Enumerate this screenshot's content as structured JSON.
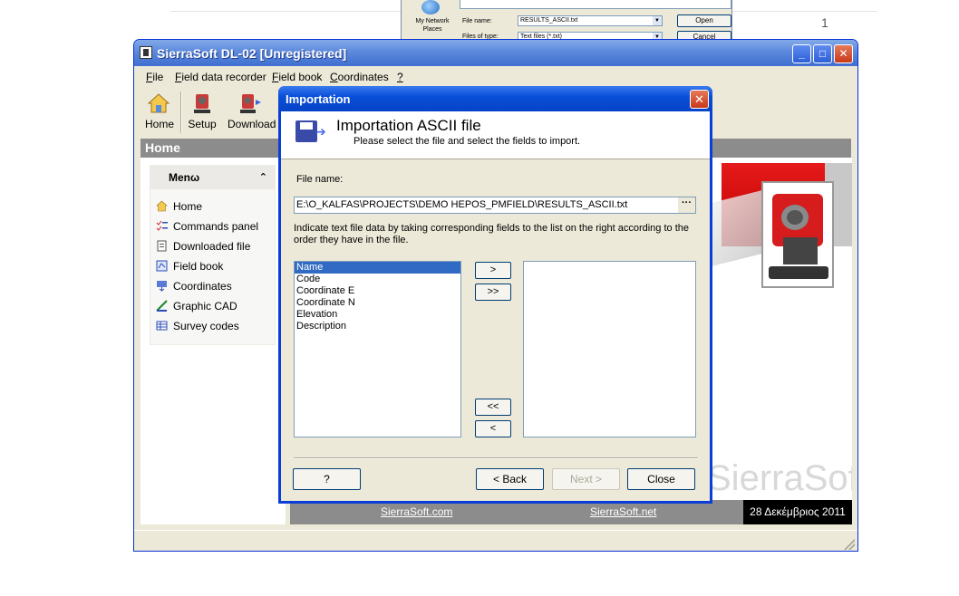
{
  "background": {
    "page_number": "1",
    "file_dialog": {
      "places_label": "My Network Places",
      "file_name_label": "File name:",
      "file_name_value": "RESULTS_ASCII.txt",
      "file_type_label": "Files of type:",
      "file_type_value": "Text files (*.txt)",
      "open_label": "Open",
      "cancel_label": "Cancel"
    }
  },
  "main_window": {
    "title": "SierraSoft DL-02 [Unregistered]",
    "controls": {
      "minimize": "_",
      "maximize": "□",
      "close": "✕"
    },
    "menu": [
      {
        "mnemonic": "F",
        "rest": "ile"
      },
      {
        "mnemonic": "F",
        "rest": "ield data recorder"
      },
      {
        "mnemonic": "F",
        "rest": "ield book"
      },
      {
        "mnemonic": "C",
        "rest": "oordinates"
      },
      {
        "mnemonic": "?",
        "rest": ""
      }
    ],
    "toolbar": [
      {
        "label": "Home",
        "icon": "house-icon"
      },
      {
        "label": "Setup",
        "icon": "setup-icon"
      },
      {
        "label": "Download",
        "icon": "download-icon"
      }
    ],
    "section_title": "Home",
    "menu_box": {
      "title": "Menω",
      "collapse_glyph": "⌃",
      "items": [
        {
          "label": "Home",
          "icon": "house-icon"
        },
        {
          "label": "Commands panel",
          "icon": "checklist-icon"
        },
        {
          "label": "Downloaded file",
          "icon": "file-icon"
        },
        {
          "label": "Field book",
          "icon": "book-icon"
        },
        {
          "label": "Coordinates",
          "icon": "coordinates-icon"
        },
        {
          "label": "Graphic CAD",
          "icon": "cad-icon"
        },
        {
          "label": "Survey codes",
          "icon": "grid-icon"
        }
      ]
    },
    "brand_text": "SierraSoft",
    "footer": {
      "link1": "SierraSoft.com",
      "link2": "SierraSoft.net",
      "date": "28 Δεκέμβριος 2011"
    },
    "colors": {
      "accent_red": "#d61c1c",
      "header_gray": "#8c8c8c"
    }
  },
  "dialog": {
    "title": "Importation",
    "close_glyph": "✕",
    "header_title": "Importation ASCII file",
    "header_subtitle": "Please select the file and select the fields to import.",
    "file_name_label": "File name:",
    "file_path": "E:\\O_KALFAS\\PROJECTS\\DEMO HEPOS_PMFIELD\\RESULTS_ASCII.txt",
    "browse_label": "···",
    "instructions": "Indicate text file data by taking corresponding fields to the list on the right according to the order they have in the file.",
    "available_fields": [
      "Name",
      "Code",
      "Coordinate E",
      "Coordinate N",
      "Elevation",
      "Description"
    ],
    "selected_index": 0,
    "buttons": {
      "add_one": ">",
      "add_all": ">>",
      "remove_all": "<<",
      "remove_one": "<",
      "help": "?",
      "back": "< Back",
      "next": "Next >",
      "close": "Close"
    }
  }
}
